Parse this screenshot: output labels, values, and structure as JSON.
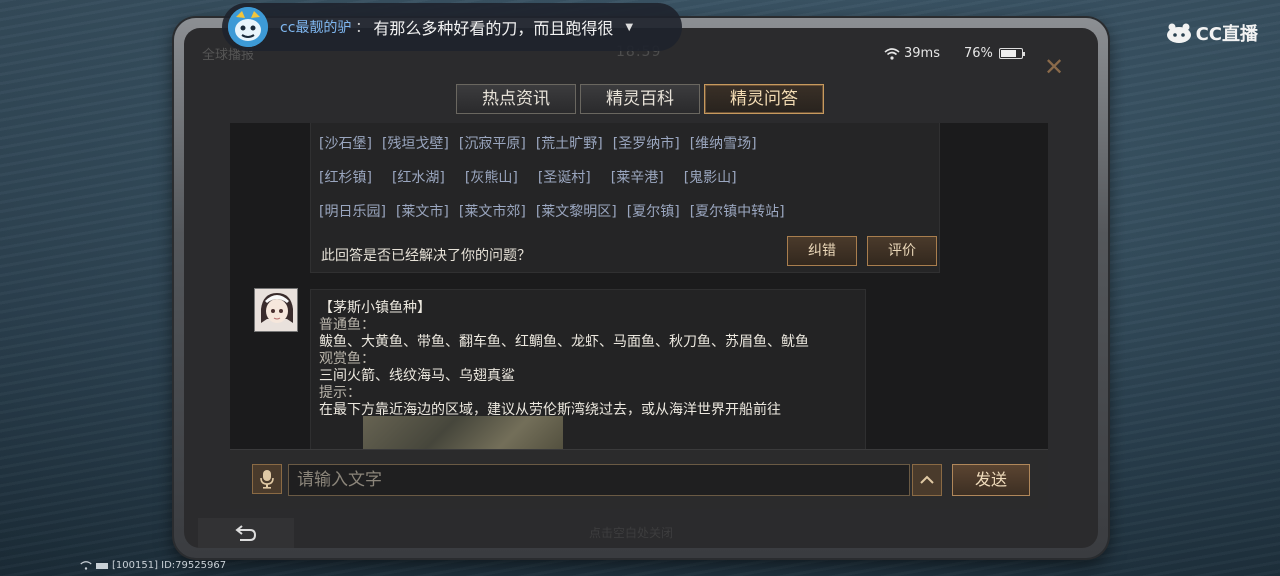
{
  "status": {
    "left_label": "全球播报",
    "time": "18:59",
    "signal": "39ms",
    "battery": "76%"
  },
  "tabs": [
    {
      "label": "热点资讯",
      "active": false
    },
    {
      "label": "精灵百科",
      "active": false
    },
    {
      "label": "精灵问答",
      "active": true
    }
  ],
  "tags": {
    "row1": [
      "[沙石堡]",
      "[残垣戈壁]",
      "[沉寂平原]",
      "[荒土旷野]",
      "[圣罗纳市]",
      "[维纳雪场]"
    ],
    "row2": [
      "[红杉镇]",
      "[红水湖]",
      "[灰熊山]",
      "[圣诞村]",
      "[莱辛港]",
      "[鬼影山]"
    ],
    "row3": [
      "[明日乐园]",
      "[莱文市]",
      "[莱文市郊]",
      "[莱文黎明区]",
      "[夏尔镇]",
      "[夏尔镇中转站]"
    ]
  },
  "question": "此回答是否已经解决了你的问题？",
  "feedback": {
    "correct": "纠错",
    "rate": "评价"
  },
  "answer": {
    "title": "【茅斯小镇鱼种】",
    "lines": [
      "普通鱼：",
      "鲅鱼、大黄鱼、带鱼、翻车鱼、红鲷鱼、龙虾、马面鱼、秋刀鱼、苏眉鱼、鱿鱼",
      "观赏鱼：",
      "三间火箭、线纹海马、乌翅真鲨",
      "提示：",
      "在最下方靠近海边的区域，建议从劳伦斯湾绕过去，或从海洋世界开船前往"
    ]
  },
  "input": {
    "placeholder": "请输入文字",
    "value": ""
  },
  "send_label": "发送",
  "close_hint": "点击空白处关闭",
  "danmaku": {
    "user": "cc最靓的驴",
    "sep": "：",
    "text": "有那么多种好看的刀，而且跑得很"
  },
  "cc_logo": "CC直播",
  "room_info": "[100151] ID:79525967",
  "colors": {
    "accent": "#c79a5e",
    "link": "#9aa6bf",
    "background": "#1b1b1c"
  }
}
